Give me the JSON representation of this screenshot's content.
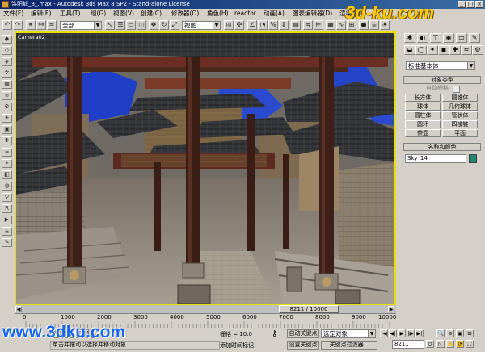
{
  "window": {
    "title": "洛阳城_8_.max - Autodesk 3ds Max 8 SP2 - Stand-alone License"
  },
  "logo": {
    "text": "3d-ku.com"
  },
  "watermark": {
    "text": "www.3dku.com"
  },
  "menu": [
    "文件(F)",
    "编辑(E)",
    "工具(T)",
    "组(G)",
    "视图(V)",
    "创建(C)",
    "修改器(O)",
    "角色(H)",
    "reactor",
    "动画(A)",
    "图表编辑器(D)",
    "渲染(R)"
  ],
  "toolbar": {
    "selection_filter": "全部",
    "ref_coord": "视图"
  },
  "viewport": {
    "label": "Camera02"
  },
  "command_panel": {
    "category": "标准基本体",
    "rollout_object_type": "对象类型",
    "autogrid_label": "自动栅格",
    "buttons": [
      "长方体",
      "圆锥体",
      "球体",
      "几何球体",
      "圆柱体",
      "管状体",
      "圆环",
      "四棱锥",
      "茶壶",
      "平面"
    ],
    "rollout_name_color": "名称和颜色",
    "object_name": "Sky_14",
    "object_color": "#1e8a72"
  },
  "timeline": {
    "position": "8211 / 10000",
    "ticks": [
      "0",
      "1000",
      "2000",
      "3000",
      "4000",
      "5000",
      "6000",
      "7000",
      "8000",
      "9000",
      "10000"
    ]
  },
  "status": {
    "selection": "未选定任何对象",
    "grid": "栅格 = 10.0",
    "autokey": "自动关键点",
    "setkey": "设置关键点",
    "selected_filter": "选定对象",
    "key_filters": "关键点过滤器...",
    "add_time_tag": "添加时间标记",
    "frame": "8211",
    "prompt": "单击并拖动以选择并移动对象"
  },
  "colors": {
    "accent_frame": "#e8e000",
    "title_blue": "#0a246a"
  }
}
